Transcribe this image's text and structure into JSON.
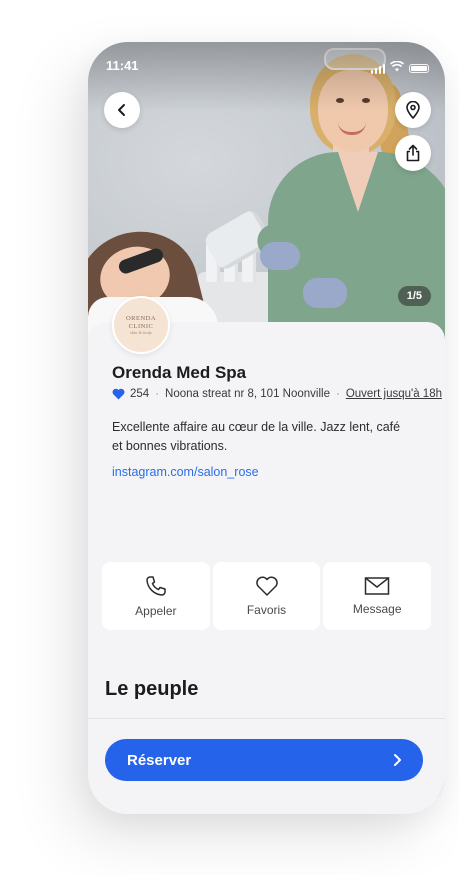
{
  "status_bar": {
    "time": "11:41"
  },
  "hero": {
    "photo_counter": "1/5"
  },
  "business": {
    "logo_line1": "ORENDA",
    "logo_line2": "CLINIC",
    "logo_line3": "skin & body",
    "name": "Orenda Med Spa",
    "likes": "254",
    "address": "Noona streat nr 8, 101 Noonville",
    "hours": "Ouvert jusqu'à 18h",
    "description": "Excellente affaire au cœur de la ville. Jazz lent, café et bonnes vibrations.",
    "instagram": "instagram.com/salon_rose"
  },
  "actions": [
    {
      "label": "Appeler",
      "icon": "phone-icon"
    },
    {
      "label": "Favoris",
      "icon": "heart-icon"
    },
    {
      "label": "Message",
      "icon": "mail-icon"
    }
  ],
  "people_section": {
    "title": "Le peuple"
  },
  "cta": {
    "label": "Réserver"
  },
  "colors": {
    "accent": "#2563eb",
    "link": "#2a6ee8",
    "background": "#f4f4f6"
  }
}
